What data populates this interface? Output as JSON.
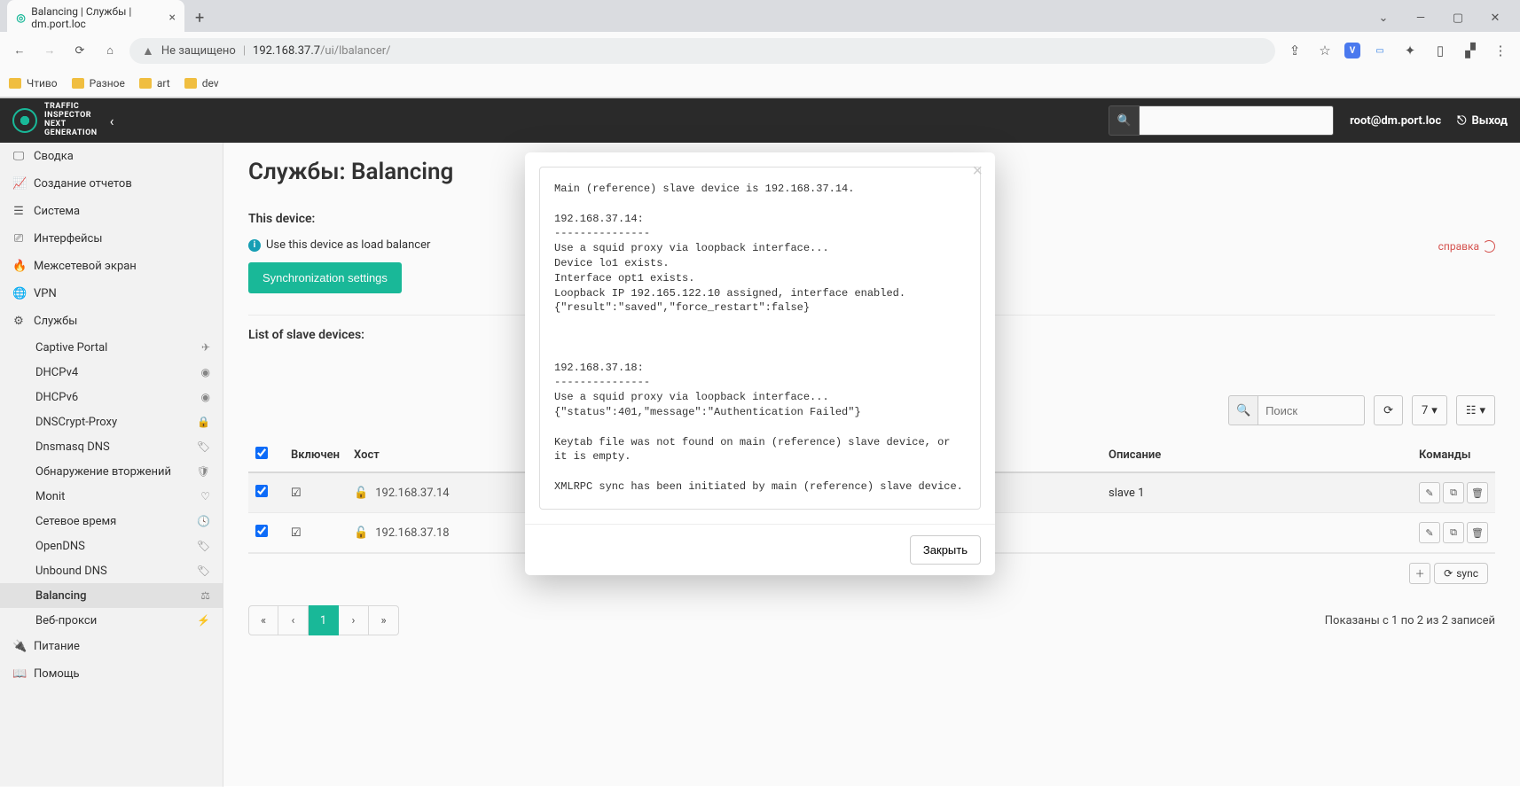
{
  "browser": {
    "tab_title": "Balancing | Службы | dm.port.loc",
    "insecure_label": "Не защищено",
    "url_host": "192.168.37.7",
    "url_path": "/ui/lbalancer/",
    "bookmarks": [
      "Чтиво",
      "Разное",
      "art",
      "dev"
    ]
  },
  "header": {
    "logo_line1": "TRAFFIC",
    "logo_line2": "INSPECTOR",
    "logo_line3": "NEXT",
    "logo_line4": "GENERATION",
    "user": "root@dm.port.loc",
    "logout": "Выход"
  },
  "sidebar": {
    "items": [
      {
        "label": "Сводка",
        "icon": "monitor"
      },
      {
        "label": "Создание отчетов",
        "icon": "chart"
      },
      {
        "label": "Система",
        "icon": "list"
      },
      {
        "label": "Интерфейсы",
        "icon": "sitemap"
      },
      {
        "label": "Межсетевой экран",
        "icon": "fire"
      },
      {
        "label": "VPN",
        "icon": "globe"
      },
      {
        "label": "Службы",
        "icon": "gear"
      },
      {
        "label": "Питание",
        "icon": "plug"
      },
      {
        "label": "Помощь",
        "icon": "book"
      }
    ],
    "subitems": [
      {
        "label": "Captive Portal",
        "badge": "send"
      },
      {
        "label": "DHCPv4",
        "badge": "target"
      },
      {
        "label": "DHCPv6",
        "badge": "target"
      },
      {
        "label": "DNSCrypt-Proxy",
        "badge": "lock"
      },
      {
        "label": "Dnsmasq DNS",
        "badge": "tag"
      },
      {
        "label": "Обнаружение вторжений",
        "badge": "shield"
      },
      {
        "label": "Monit",
        "badge": "heart"
      },
      {
        "label": "Сетевое время",
        "badge": "clock"
      },
      {
        "label": "OpenDNS",
        "badge": "tag"
      },
      {
        "label": "Unbound DNS",
        "badge": "tag"
      },
      {
        "label": "Balancing",
        "badge": "balance",
        "active": true
      },
      {
        "label": "Веб-прокси",
        "badge": "bolt"
      }
    ]
  },
  "page": {
    "title": "Службы: Balancing",
    "this_device": "This device:",
    "use_lb": "Use this device as load balancer",
    "sync_settings": "Synchronization settings",
    "help": "справка",
    "list_label": "List of slave devices:",
    "search_placeholder": "Поиск",
    "page_size": "7",
    "columns": {
      "enabled": "Включен",
      "host": "Хост",
      "desc": "Описание",
      "cmds": "Команды"
    },
    "rows": [
      {
        "enabled": true,
        "host": "192.168.37.14",
        "desc": "slave 1"
      },
      {
        "enabled": true,
        "host": "192.168.37.18",
        "desc": ""
      }
    ],
    "sync": "sync",
    "records": "Показаны с 1 по 2 из 2 записей",
    "pager_current": "1"
  },
  "modal": {
    "content": "Main (reference) slave device is 192.168.37.14.\n\n192.168.37.14:\n---------------\nUse a squid proxy via loopback interface...\nDevice lo1 exists.\nInterface opt1 exists.\nLoopback IP 192.165.122.10 assigned, interface enabled.\n{\"result\":\"saved\",\"force_restart\":false}\n\n\n\n192.168.37.18:\n---------------\nUse a squid proxy via loopback interface...\n{\"status\":401,\"message\":\"Authentication Failed\"}\n\nKeytab file was not found on main (reference) slave device, or it is empty.\n\nXMLRPC sync has been initiated by main (reference) slave device.",
    "close": "Закрыть"
  }
}
